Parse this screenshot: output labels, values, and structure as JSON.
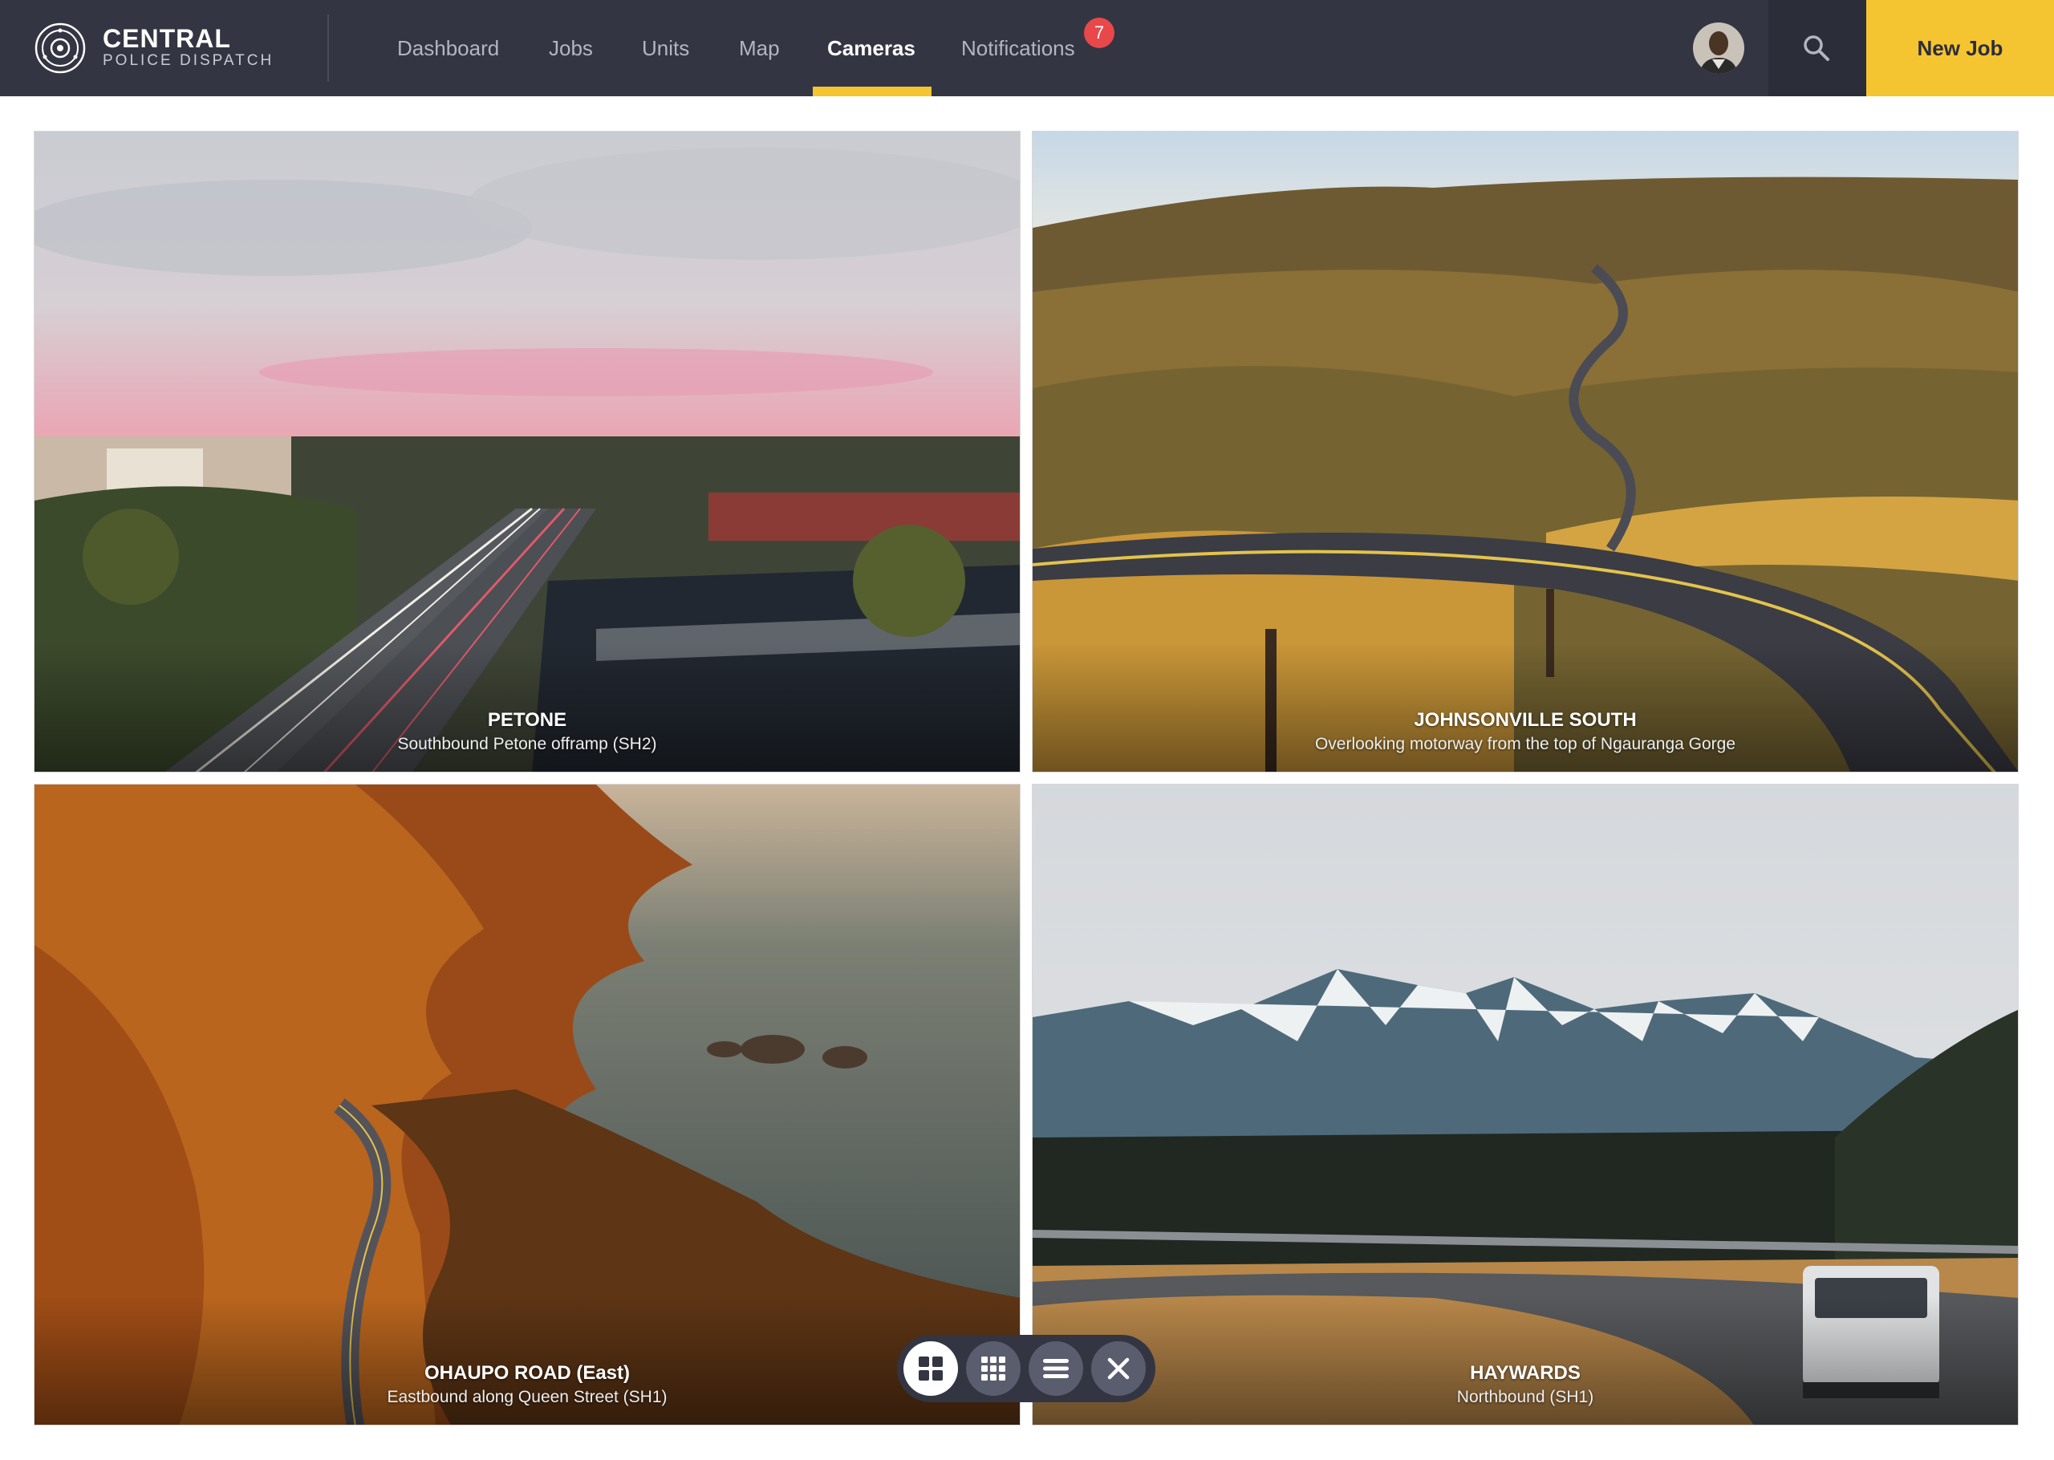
{
  "app": {
    "brand_title": "CENTRAL",
    "brand_subtitle": "POLICE DISPATCH"
  },
  "nav": {
    "items": [
      {
        "label": "Dashboard"
      },
      {
        "label": "Jobs"
      },
      {
        "label": "Units"
      },
      {
        "label": "Map"
      },
      {
        "label": "Cameras",
        "active": true
      },
      {
        "label": "Notifications",
        "badge": "7"
      }
    ]
  },
  "header": {
    "new_job_label": "New Job"
  },
  "cameras": [
    {
      "title": "PETONE",
      "subtitle": "Southbound Petone offramp (SH2)"
    },
    {
      "title": "JOHNSONVILLE SOUTH",
      "subtitle": "Overlooking motorway from the top of Ngauranga Gorge"
    },
    {
      "title": "OHAUPO ROAD (East)",
      "subtitle": "Eastbound along Queen Street (SH1)"
    },
    {
      "title": "HAYWARDS",
      "subtitle": "Northbound (SH1)"
    }
  ],
  "view_controls": {
    "active": "grid-large"
  },
  "colors": {
    "header_bg": "#333542",
    "accent": "#f5c431",
    "badge": "#e8484a"
  }
}
